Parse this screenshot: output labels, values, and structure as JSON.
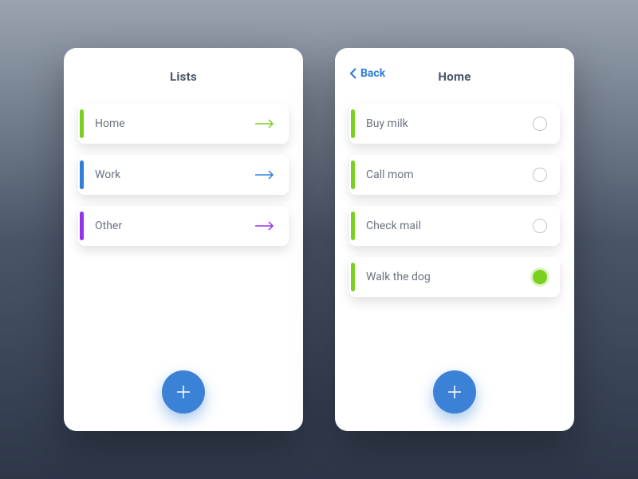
{
  "colors": {
    "green": "#7ad01f",
    "blue": "#2f7ed8",
    "purple": "#9333ea",
    "fab": "#3b82d6"
  },
  "left": {
    "title": "Lists",
    "items": [
      {
        "label": "Home",
        "accent": "#7ad01f",
        "arrow": "#7ad01f"
      },
      {
        "label": "Work",
        "accent": "#2f7ed8",
        "arrow": "#2f7ed8"
      },
      {
        "label": "Other",
        "accent": "#9333ea",
        "arrow": "#9333ea"
      }
    ]
  },
  "right": {
    "back": "Back",
    "title": "Home",
    "accent": "#7ad01f",
    "tasks": [
      {
        "label": "Buy milk",
        "done": false
      },
      {
        "label": "Call mom",
        "done": false
      },
      {
        "label": "Check mail",
        "done": false
      },
      {
        "label": "Walk the dog",
        "done": true
      }
    ]
  }
}
